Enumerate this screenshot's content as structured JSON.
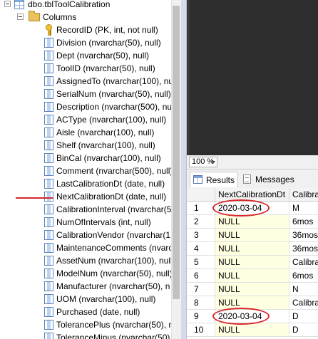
{
  "object_explorer": {
    "table": "dbo.tblToolCalibration",
    "folder": "Columns",
    "columns": [
      "RecordID (PK, int, not null)",
      "Division (nvarchar(50), null)",
      "Dept (nvarchar(50), null)",
      "ToolID (nvarchar(50), null)",
      "AssignedTo (nvarchar(100), nu",
      "SerialNum (nvarchar(50), null)",
      "Description (nvarchar(500), nu",
      "ACType (nvarchar(100), null)",
      "Aisle (nvarchar(100), null)",
      "Shelf (nvarchar(100), null)",
      "BinCal (nvarchar(100), null)",
      "Comment (nvarchar(500), null)",
      "LastCalibrationDt (date, null)",
      "NextCalibrationDt (date, null)",
      "CalibrationInterval (nvarchar(5",
      "NumOfIntervals (int, null)",
      "CalibrationVendor (nvarchar(1",
      "MaintenanceComments (nvarch",
      "AssetNum (nvarchar(100), null)",
      "ModelNum (nvarchar(50), null)",
      "Manufacturer (nvarchar(50), n",
      "UOM (nvarchar(100), null)",
      "Purchased (date, null)",
      "TolerancePlus (nvarchar(50), n",
      "ToleranceMinus (nvarchar(50)"
    ],
    "highlighted_column_index": 13
  },
  "query_editor": {
    "zoom": "100 %"
  },
  "results_tabs": {
    "results": "Results",
    "messages": "Messages"
  },
  "results_grid": {
    "headers": [
      "NextCalibrationDt",
      "Calibrat"
    ],
    "rows": [
      {
        "num": "1",
        "next_dt": "2020-03-04",
        "interval": "M"
      },
      {
        "num": "2",
        "next_dt": "NULL",
        "interval": "6mos"
      },
      {
        "num": "3",
        "next_dt": "NULL",
        "interval": "36mos"
      },
      {
        "num": "4",
        "next_dt": "NULL",
        "interval": "36mos"
      },
      {
        "num": "5",
        "next_dt": "NULL",
        "interval": "Calibrat"
      },
      {
        "num": "6",
        "next_dt": "NULL",
        "interval": "6mos"
      },
      {
        "num": "7",
        "next_dt": "NULL",
        "interval": "N"
      },
      {
        "num": "8",
        "next_dt": "NULL",
        "interval": "Calibrat"
      },
      {
        "num": "9",
        "next_dt": "2020-03-04",
        "interval": "D"
      },
      {
        "num": "10",
        "next_dt": "NULL",
        "interval": "D"
      }
    ],
    "circled_rows": [
      0,
      8
    ]
  },
  "colors": {
    "annotation": "#d8262a",
    "null_cell_bg": "#ffffe1",
    "editor_bg": "#2d2d2d"
  }
}
